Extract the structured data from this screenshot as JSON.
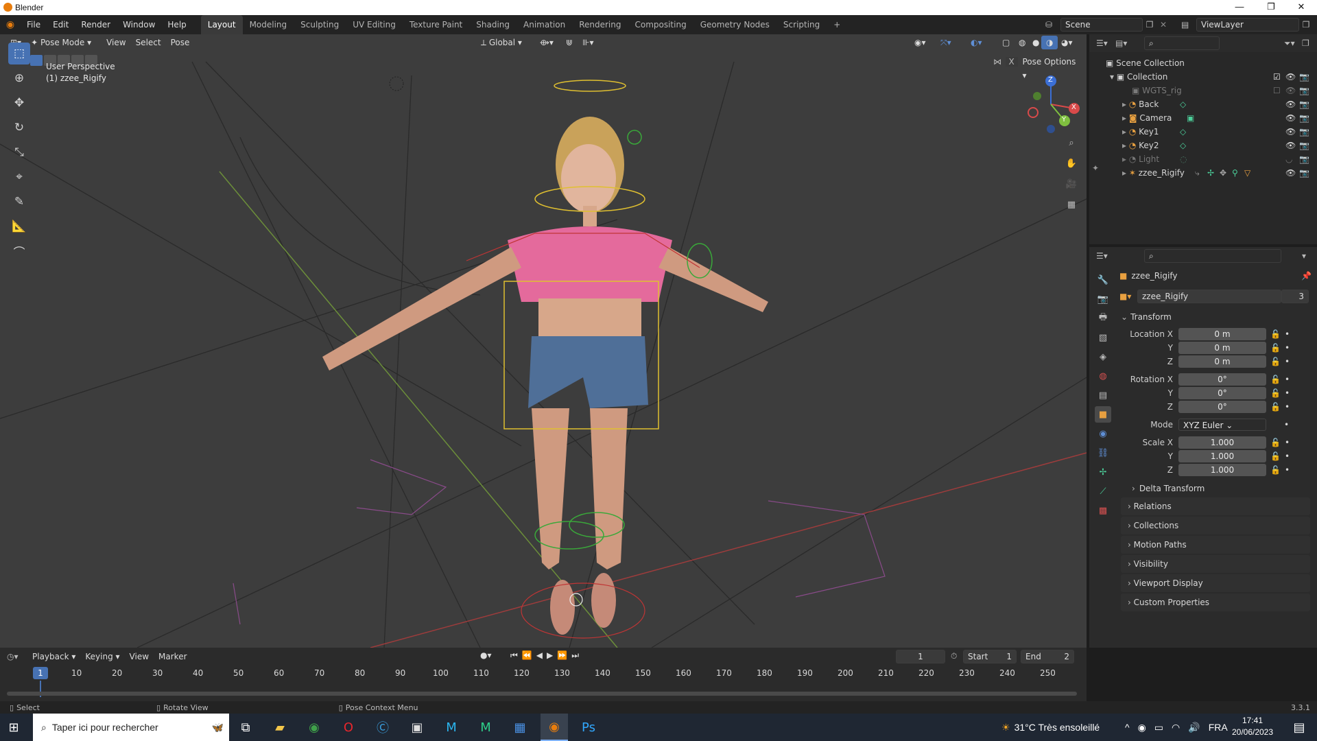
{
  "window": {
    "title": "Blender",
    "minimize": "—",
    "maximize": "❐",
    "close": "✕"
  },
  "menus": [
    "File",
    "Edit",
    "Render",
    "Window",
    "Help"
  ],
  "workspaces": [
    "Layout",
    "Modeling",
    "Sculpting",
    "UV Editing",
    "Texture Paint",
    "Shading",
    "Animation",
    "Rendering",
    "Compositing",
    "Geometry Nodes",
    "Scripting"
  ],
  "active_workspace": "Layout",
  "scene": {
    "name": "Scene",
    "view_layer": "ViewLayer"
  },
  "viewport": {
    "mode": "Pose Mode",
    "menus": [
      "View",
      "Select",
      "Pose"
    ],
    "orientation": "Global",
    "pose_options": "Pose Options",
    "perspective": "User Perspective",
    "object_label": "(1) zzee_Rigify",
    "gizmo_axes": {
      "x": "X",
      "y": "Y",
      "z": "Z"
    }
  },
  "outliner": {
    "root": "Scene Collection",
    "collection": "Collection",
    "items": [
      {
        "name": "WGTS_rig",
        "dim": true
      },
      {
        "name": "Back",
        "dim": false
      },
      {
        "name": "Camera",
        "dim": false
      },
      {
        "name": "Key1",
        "dim": false
      },
      {
        "name": "Key2",
        "dim": false
      },
      {
        "name": "Light",
        "dim": true
      },
      {
        "name": "zzee_Rigify",
        "dim": false
      }
    ]
  },
  "properties": {
    "object_name": "zzee_Rigify",
    "data_name": "zzee_Rigify",
    "users": "3",
    "transform_title": "Transform",
    "location": {
      "label": "Location X",
      "x": "0 m",
      "y": "0 m",
      "z": "0 m"
    },
    "rotation": {
      "label": "Rotation X",
      "x": "0°",
      "y": "0°",
      "z": "0°"
    },
    "mode_label": "Mode",
    "mode_value": "XYZ Euler",
    "scale": {
      "label": "Scale X",
      "x": "1.000",
      "y": "1.000",
      "z": "1.000"
    },
    "axis_y": "Y",
    "axis_z": "Z",
    "delta": "Delta Transform",
    "panels": [
      "Relations",
      "Collections",
      "Motion Paths",
      "Visibility",
      "Viewport Display",
      "Custom Properties"
    ]
  },
  "timeline": {
    "menus": [
      "Playback",
      "Keying",
      "View",
      "Marker"
    ],
    "current_frame": "1",
    "start_label": "Start",
    "start": "1",
    "end_label": "End",
    "end": "2",
    "ruler": [
      "1",
      "10",
      "20",
      "30",
      "40",
      "50",
      "60",
      "70",
      "80",
      "90",
      "100",
      "110",
      "120",
      "130",
      "140",
      "150",
      "160",
      "170",
      "180",
      "190",
      "200",
      "210",
      "220",
      "230",
      "240",
      "250"
    ]
  },
  "statusbar": {
    "select": "Select",
    "rotate": "Rotate View",
    "context": "Pose Context Menu",
    "version": "3.3.1"
  },
  "taskbar": {
    "search_placeholder": "Taper ici pour rechercher",
    "weather": "31°C  Très ensoleillé",
    "lang": "FRA",
    "time": "17:41",
    "date": "20/06/2023"
  }
}
